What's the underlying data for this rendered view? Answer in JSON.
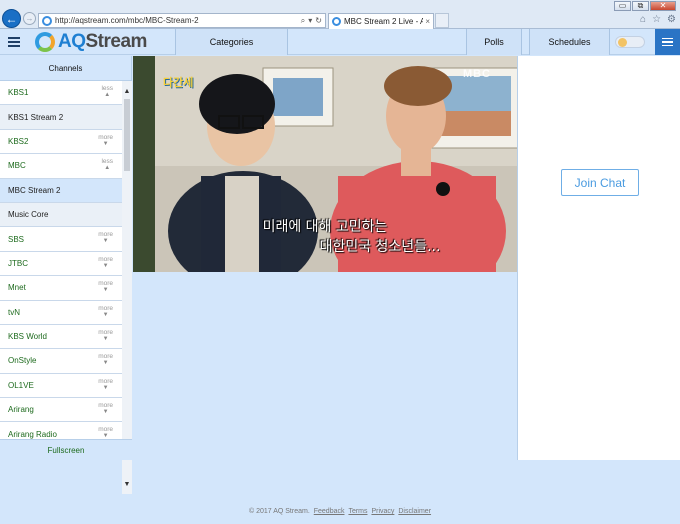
{
  "browser": {
    "url": "http://aqstream.com/mbc/MBC-Stream-2",
    "tab_title": "MBC Stream 2 Live - AQ ...",
    "tab_close": "×",
    "window_controls": [
      "▭",
      "⧉",
      "✕"
    ],
    "icons": [
      "back-arrow-icon",
      "forward-arrow-icon",
      "search-icon",
      "refresh-icon",
      "home-icon",
      "star-icon",
      "settings-icon"
    ]
  },
  "header": {
    "logo_aq": "AQ",
    "logo_stream": "Stream",
    "nav": [
      "Categories",
      "Polls",
      "Schedules"
    ],
    "night_mode_on": false
  },
  "sidebar": {
    "title": "Channels",
    "channels": [
      {
        "label": "KBS1",
        "toggle": "less",
        "arrow": "▲"
      },
      {
        "label": "KBS1 Stream 2",
        "sub": true
      },
      {
        "label": "KBS2",
        "toggle": "more",
        "arrow": "▼"
      },
      {
        "label": "MBC",
        "toggle": "less",
        "arrow": "▲"
      },
      {
        "label": "MBC Stream 2",
        "active": true
      },
      {
        "label": "Music Core",
        "sub": true
      },
      {
        "label": "SBS",
        "toggle": "more",
        "arrow": "▼"
      },
      {
        "label": "JTBC",
        "toggle": "more",
        "arrow": "▼"
      },
      {
        "label": "Mnet",
        "toggle": "more",
        "arrow": "▼"
      },
      {
        "label": "tvN",
        "toggle": "more",
        "arrow": "▼"
      },
      {
        "label": "KBS World",
        "toggle": "more",
        "arrow": "▼"
      },
      {
        "label": "OnStyle",
        "toggle": "more",
        "arrow": "▼"
      },
      {
        "label": "OL1VE",
        "toggle": "more",
        "arrow": "▼"
      },
      {
        "label": "Arirang",
        "toggle": "more",
        "arrow": "▼"
      },
      {
        "label": "Arirang Radio",
        "toggle": "more",
        "arrow": "▼"
      }
    ],
    "fullscreen": "Fullscreen"
  },
  "video": {
    "watermark": "MBC",
    "show_logo": "다간세",
    "caption_line1": "미래에 대해 고민하는",
    "caption_line2": "대한민국 청소년들..."
  },
  "chat": {
    "join_label": "Join Chat"
  },
  "footer": {
    "copyright": "© 2017 AQ Stream.",
    "links": [
      "Feedback",
      "Terms",
      "Privacy",
      "Disclaimer"
    ]
  },
  "colors": {
    "page_bg": "#d3e6fb",
    "brand_blue": "#1e7fd2",
    "channel_green": "#1d6a1d",
    "join_border": "#6faee6"
  }
}
